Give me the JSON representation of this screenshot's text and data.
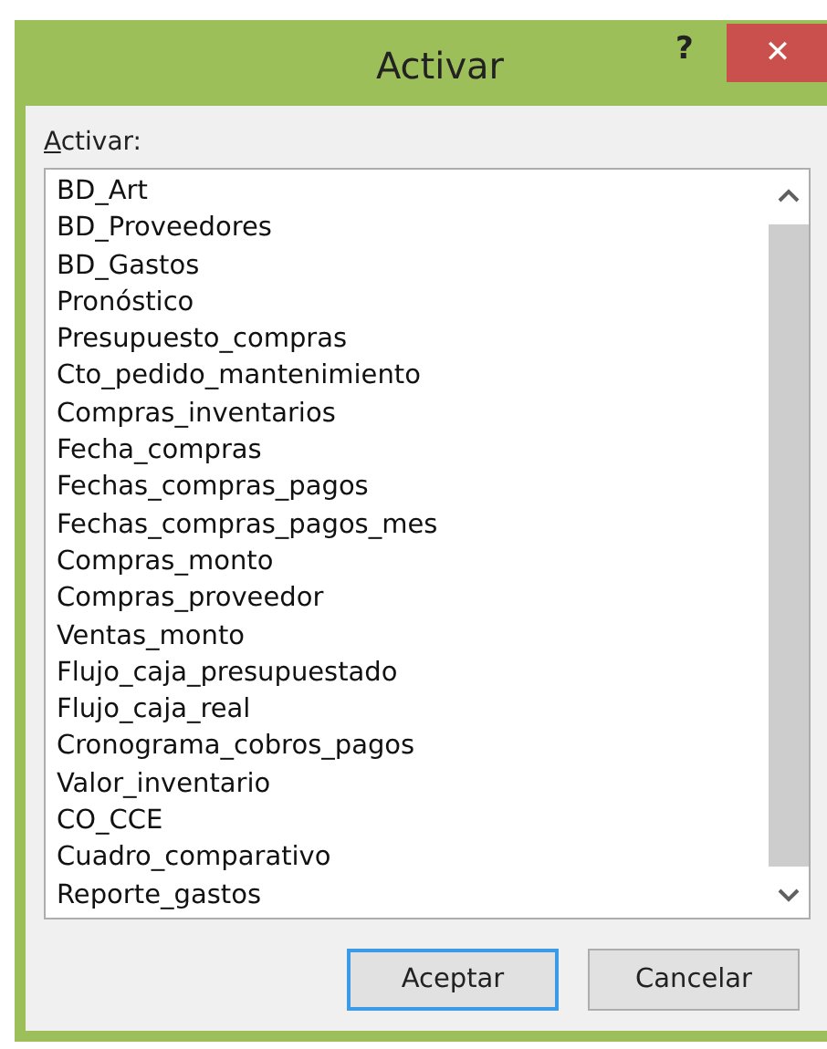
{
  "window": {
    "title": "Activar",
    "help": "?",
    "close": "✕"
  },
  "list_label": "Activar:",
  "items": [
    "BD_Art",
    "BD_Proveedores",
    "BD_Gastos",
    "Pronóstico",
    "Presupuesto_compras",
    "Cto_pedido_mantenimiento",
    "Compras_inventarios",
    "Fecha_compras",
    "Fechas_compras_pagos",
    "Fechas_compras_pagos_mes",
    "Compras_monto",
    "Compras_proveedor",
    "Ventas_monto",
    "Flujo_caja_presupuestado",
    "Flujo_caja_real",
    "Cronograma_cobros_pagos",
    "Valor_inventario",
    "CO_CCE",
    "Cuadro_comparativo",
    "Reporte_gastos"
  ],
  "buttons": [
    "Aceptar",
    "Cancelar"
  ]
}
